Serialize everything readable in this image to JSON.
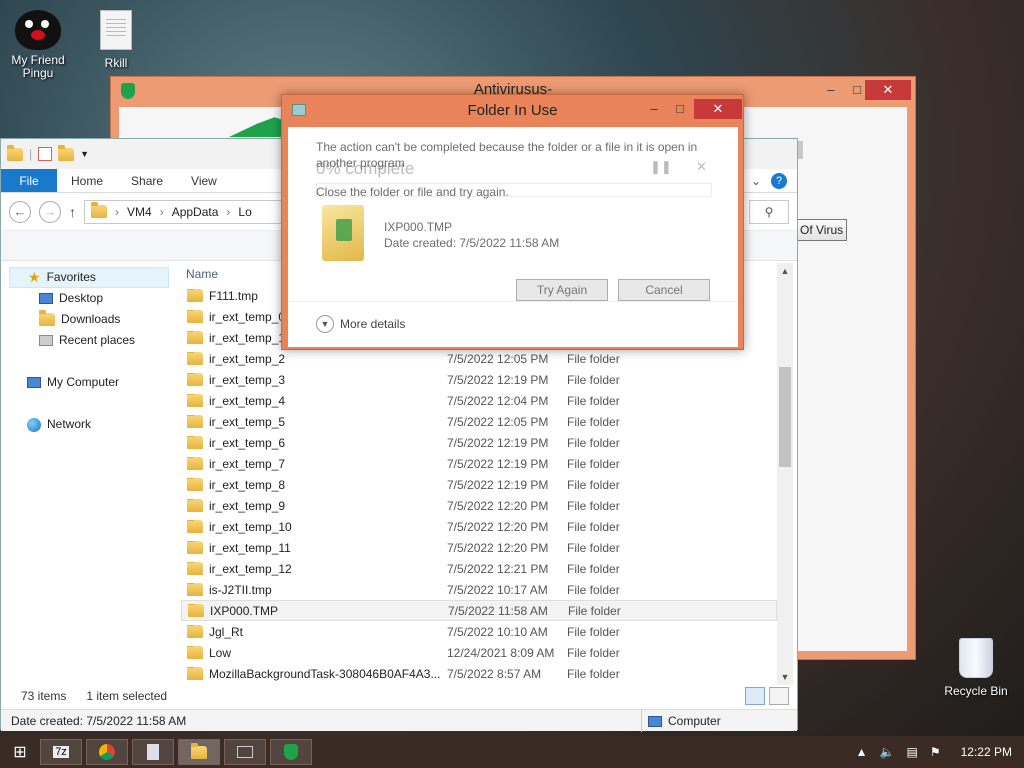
{
  "desktop": {
    "icons": [
      {
        "label": "My Friend Pingu"
      },
      {
        "label": "Rkill"
      },
      {
        "label": "Recycle Bin"
      }
    ]
  },
  "antivirus": {
    "title": "Antivirusus-",
    "virus_button": "Of Virus"
  },
  "explorer": {
    "tabs": [
      "File",
      "Home",
      "Share",
      "View"
    ],
    "breadcrumb": [
      "VM4",
      "AppData",
      "Lo"
    ],
    "nav": {
      "favorites": "Favorites",
      "desktop": "Desktop",
      "downloads": "Downloads",
      "recent": "Recent places",
      "computer": "My Computer",
      "network": "Network"
    },
    "column_name": "Name",
    "files": [
      {
        "name": "F111.tmp",
        "date": "",
        "type": ""
      },
      {
        "name": "ir_ext_temp_0",
        "date": "",
        "type": ""
      },
      {
        "name": "ir_ext_temp_1",
        "date": "",
        "type": ""
      },
      {
        "name": "ir_ext_temp_2",
        "date": "7/5/2022 12:05 PM",
        "type": "File folder"
      },
      {
        "name": "ir_ext_temp_3",
        "date": "7/5/2022 12:19 PM",
        "type": "File folder"
      },
      {
        "name": "ir_ext_temp_4",
        "date": "7/5/2022 12:04 PM",
        "type": "File folder"
      },
      {
        "name": "ir_ext_temp_5",
        "date": "7/5/2022 12:05 PM",
        "type": "File folder"
      },
      {
        "name": "ir_ext_temp_6",
        "date": "7/5/2022 12:19 PM",
        "type": "File folder"
      },
      {
        "name": "ir_ext_temp_7",
        "date": "7/5/2022 12:19 PM",
        "type": "File folder"
      },
      {
        "name": "ir_ext_temp_8",
        "date": "7/5/2022 12:19 PM",
        "type": "File folder"
      },
      {
        "name": "ir_ext_temp_9",
        "date": "7/5/2022 12:20 PM",
        "type": "File folder"
      },
      {
        "name": "ir_ext_temp_10",
        "date": "7/5/2022 12:20 PM",
        "type": "File folder"
      },
      {
        "name": "ir_ext_temp_11",
        "date": "7/5/2022 12:20 PM",
        "type": "File folder"
      },
      {
        "name": "ir_ext_temp_12",
        "date": "7/5/2022 12:21 PM",
        "type": "File folder"
      },
      {
        "name": "is-J2TII.tmp",
        "date": "7/5/2022 10:17 AM",
        "type": "File folder"
      },
      {
        "name": "IXP000.TMP",
        "date": "7/5/2022 11:58 AM",
        "type": "File folder",
        "selected": true
      },
      {
        "name": "Jgl_Rt",
        "date": "7/5/2022 10:10 AM",
        "type": "File folder"
      },
      {
        "name": "Low",
        "date": "12/24/2021 8:09 AM",
        "type": "File folder"
      },
      {
        "name": "MozillaBackgroundTask-308046B0AF4A3...",
        "date": "7/5/2022 8:57 AM",
        "type": "File folder"
      }
    ],
    "status_items": "73 items",
    "status_selected": "1 item selected",
    "details_date": "Date created: 7/5/2022 11:58 AM",
    "details_location": "Computer"
  },
  "dialog": {
    "title": "Folder In Use",
    "message": "The action can't be completed because the folder or a file in it is open in another program",
    "ghost_progress": "0% complete",
    "hint": "Close the folder or file and try again.",
    "file_name": "IXP000.TMP",
    "file_date": "Date created: 7/5/2022 11:58 AM",
    "try_again": "Try Again",
    "cancel": "Cancel",
    "more_details": "More details"
  },
  "taskbar": {
    "time": "12:22 PM",
    "zip_label": "7z"
  }
}
